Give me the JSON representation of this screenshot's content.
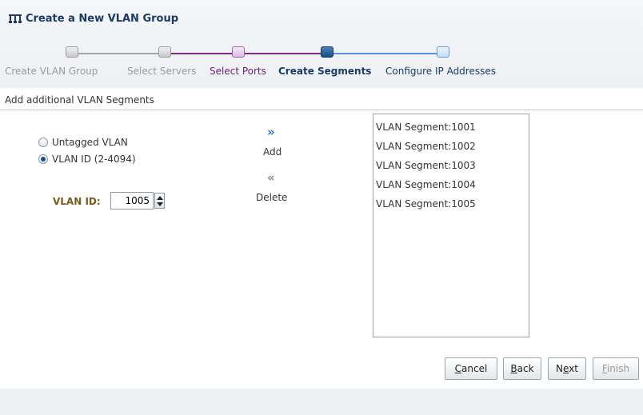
{
  "dialog": {
    "title": "Create a New VLAN Group",
    "icon": "network-icon"
  },
  "train": {
    "steps": [
      {
        "label": "Create VLAN Group",
        "state": "done"
      },
      {
        "label": "Select Servers",
        "state": "done"
      },
      {
        "label": "Select Ports",
        "state": "visited"
      },
      {
        "label": "Create Segments",
        "state": "current"
      },
      {
        "label": "Configure IP Addresses",
        "state": "future"
      }
    ]
  },
  "section": {
    "title": "Add additional VLAN Segments"
  },
  "options": {
    "untagged_label": "Untagged VLAN",
    "vlan_id_label": "VLAN ID (2-4094)",
    "selected": "VLAN ID (2-4094)"
  },
  "vlan_id": {
    "label": "VLAN ID:",
    "value": "1005"
  },
  "shuttle": {
    "add_label": "Add",
    "delete_label": "Delete",
    "add_icon": "double-chevron-right-icon",
    "delete_icon": "double-chevron-left-icon"
  },
  "segments": [
    "VLAN Segment:1001",
    "VLAN Segment:1002",
    "VLAN Segment:1003",
    "VLAN Segment:1004",
    "VLAN Segment:1005"
  ],
  "buttons": {
    "cancel": {
      "pre": "",
      "key": "C",
      "post": "ancel"
    },
    "back": {
      "pre": "",
      "key": "B",
      "post": "ack"
    },
    "next": {
      "pre": "N",
      "key": "e",
      "post": "xt"
    },
    "finish": {
      "pre": "",
      "key": "F",
      "post": "inish"
    }
  },
  "colors": {
    "accent": "#1c3a63",
    "visited": "#6b1f78",
    "done": "#9a9a9a"
  }
}
